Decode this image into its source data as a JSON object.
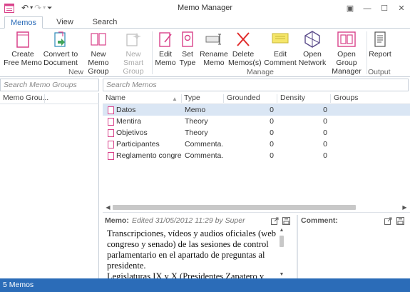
{
  "window": {
    "title": "Memo Manager",
    "qat": {
      "undo": "↶",
      "undo_drop": "▾",
      "redo": "↷",
      "redo_drop": "▾",
      "customize": "⏷"
    },
    "controls": {
      "restore": "▣",
      "minimize": "—",
      "maximize": "☐",
      "close": "✕"
    }
  },
  "tabs": [
    {
      "label": "Memos",
      "active": true
    },
    {
      "label": "View",
      "active": false
    },
    {
      "label": "Search",
      "active": false
    }
  ],
  "ribbon": {
    "groups": {
      "new": "New",
      "manage": "Manage",
      "output": "Output"
    },
    "buttons": {
      "create_free_memo": [
        "Create",
        "Free Memo"
      ],
      "convert_to_document": [
        "Convert to",
        "Document"
      ],
      "new_memo_group": [
        "New Memo",
        "Group"
      ],
      "new_smart_group": [
        "New Smart",
        "Group"
      ],
      "edit_memo": [
        "Edit",
        "Memo"
      ],
      "set_type": [
        "Set",
        "Type"
      ],
      "rename_memo": [
        "Rename",
        "Memo"
      ],
      "delete_memos": [
        "Delete",
        "Memos(s)"
      ],
      "edit_comment": [
        "Edit",
        "Comment"
      ],
      "open_network": [
        "Open",
        "Network"
      ],
      "open_group_manager": [
        "Open Group",
        "Manager"
      ],
      "report": [
        "Report",
        ""
      ]
    }
  },
  "left": {
    "search_placeholder": "Search Memo Groups",
    "column_header": "Memo Grou..."
  },
  "main": {
    "search_placeholder": "Search Memos",
    "columns": [
      "Name",
      "Type",
      "Grounded",
      "Density",
      "Groups"
    ],
    "rows": [
      {
        "name": "Datos",
        "type": "Memo",
        "grounded": "0",
        "density": "0",
        "groups": "",
        "selected": true
      },
      {
        "name": "Mentira",
        "type": "Theory",
        "grounded": "0",
        "density": "0",
        "groups": "",
        "selected": false
      },
      {
        "name": "Objetivos",
        "type": "Theory",
        "grounded": "0",
        "density": "0",
        "groups": "",
        "selected": false
      },
      {
        "name": "Participantes",
        "type": "Commenta...",
        "grounded": "0",
        "density": "0",
        "groups": "",
        "selected": false
      },
      {
        "name": "Reglamento congre...",
        "type": "Commenta...",
        "grounded": "0",
        "density": "0",
        "groups": "",
        "selected": false
      }
    ]
  },
  "memo": {
    "label": "Memo:",
    "meta": "Edited 31/05/2012 11:29 by Super",
    "text": "Transcripciones, vídeos y audios oficiales (web congreso y senado) de las sesiones de control parlamentario en el apartado de preguntas al presidente.\nLegislaturas IX y X (Presidentes Zapatero y"
  },
  "comment": {
    "label": "Comment:"
  },
  "status": {
    "text": "5 Memos"
  },
  "colors": {
    "accent": "#2b6cb8",
    "memo_icon": "#d9428a",
    "selection": "#dae6f4"
  }
}
